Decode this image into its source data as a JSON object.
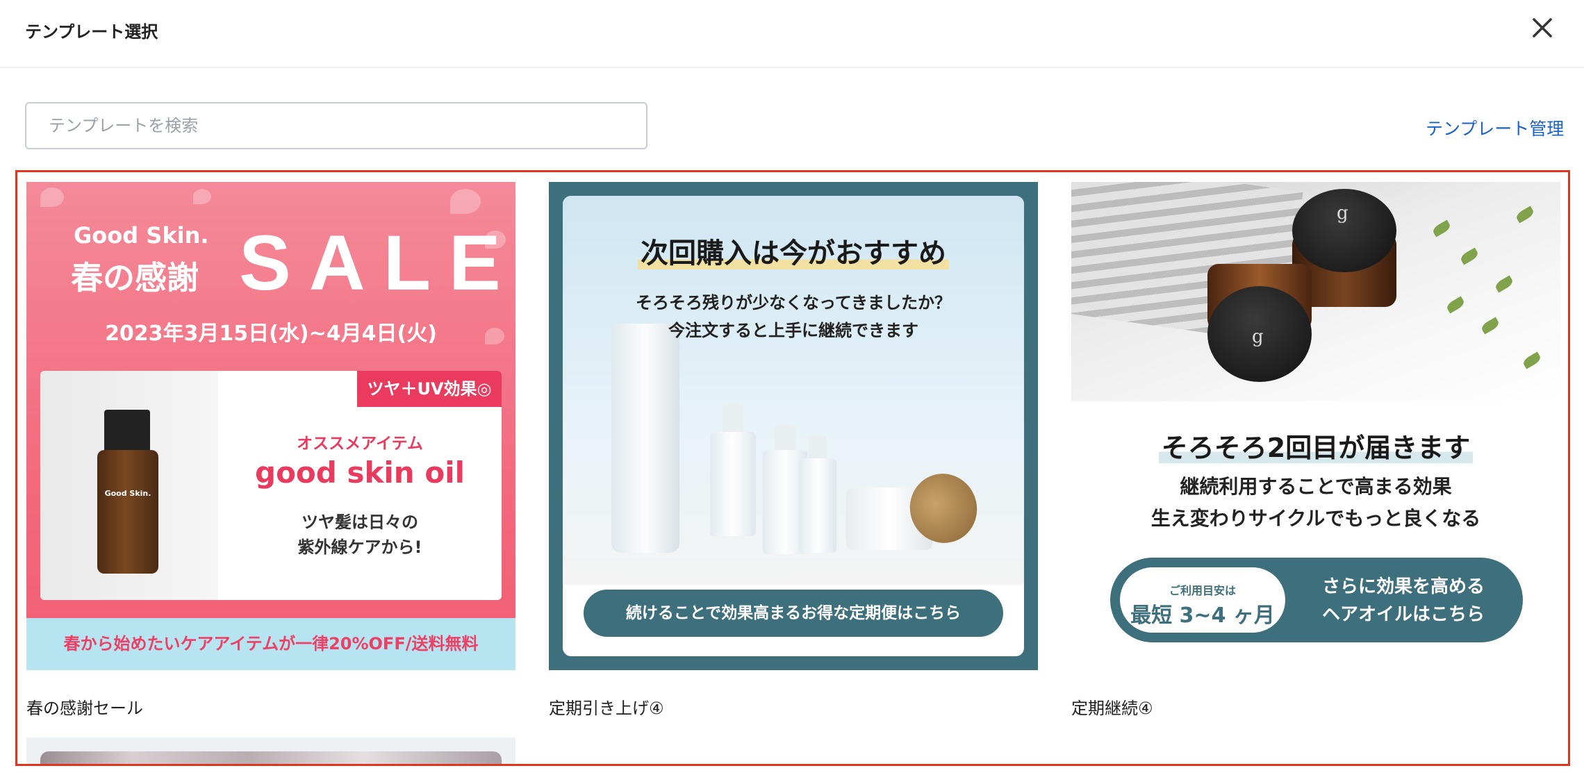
{
  "header": {
    "title": "テンプレート選択"
  },
  "search": {
    "placeholder": "テンプレートを検索"
  },
  "toolbar": {
    "manage_label": "テンプレート管理"
  },
  "templates": [
    {
      "caption": "春の感謝セール",
      "banner": {
        "brand": "Good Skin.",
        "headline": "春の感謝",
        "sale": "SALE",
        "dates": "2023年3月15日(水)~4月4日(火)",
        "tag": "ツヤ＋UV効果◎",
        "recommend": "オススメアイテム",
        "product": "good skin oil",
        "copy_line1": "ツヤ髪は日々の",
        "copy_line2": "紫外線ケアから!",
        "bottle_label": "Good Skin.",
        "band": "春から始めたいケアアイテムが一律20%OFF/送料無料"
      }
    },
    {
      "caption": "定期引き上げ④",
      "banner": {
        "headline": "次回購入は今がおすすめ",
        "sub_line1": "そろそろ残りが少なくなってきましたか？",
        "sub_line2": "今注文すると上手に継続できます",
        "button": "続けることで効果高まるお得な定期便はこちら"
      }
    },
    {
      "caption": "定期継続④",
      "banner": {
        "headline": "そろそろ2回目が届きます",
        "sub_line1": "継続利用することで高まる効果",
        "sub_line2": "生え変わりサイクルでもっと良くなる",
        "guide": "ご利用目安は",
        "period": "最短 3~4 ヶ月",
        "cta_line1": "さらに効果を高める",
        "cta_line2": "ヘアオイルはこちら"
      }
    },
    {
      "caption": ""
    }
  ],
  "colors": {
    "accent_link": "#1a63c6",
    "selection_border": "#e0341c",
    "sale_pink": "#f36a7e",
    "teal": "#3e6f7d"
  },
  "icons": {
    "close": "close-icon"
  }
}
